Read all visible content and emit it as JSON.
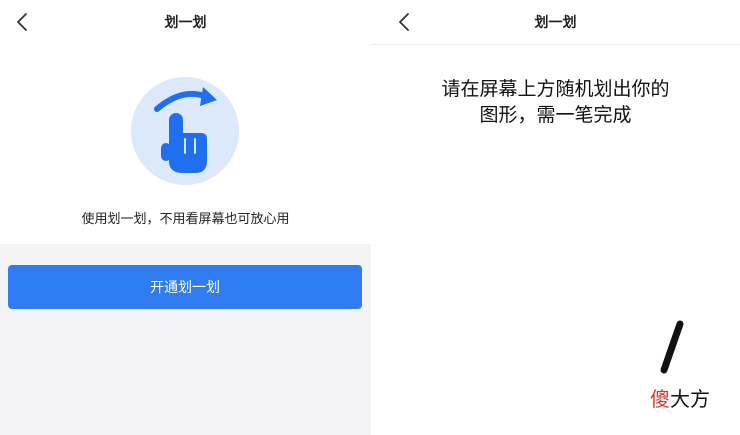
{
  "left_screen": {
    "nav": {
      "title": "划一划",
      "back_icon": "chevron-left-icon"
    },
    "hero_icon": "swipe-hand-icon",
    "description": "使用划一划，不用看屏幕也可放心用",
    "enable_button_label": "开通划一划",
    "colors": {
      "accent": "#2f7bf0",
      "hero_bg": "#dbe9fb",
      "footer_bg": "#f4f4f6"
    }
  },
  "right_screen": {
    "nav": {
      "title": "划一划",
      "back_icon": "chevron-left-icon"
    },
    "instruction_line1": "请在屏幕上方随机划出你的",
    "instruction_line2": "图形，需一笔完成"
  },
  "watermark": {
    "part1": "傻",
    "part2": "大方",
    "color_part1": "#e4322b"
  }
}
